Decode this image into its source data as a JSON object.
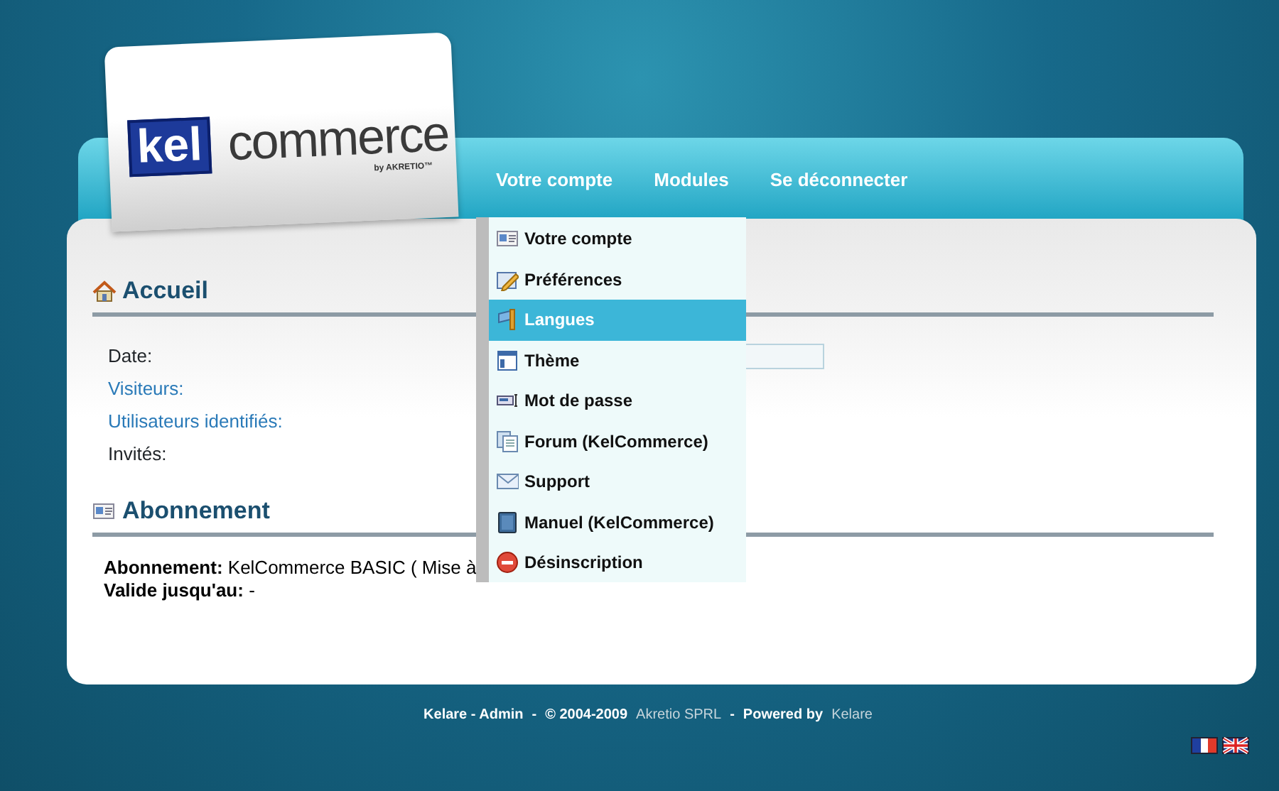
{
  "logo": {
    "mark": "kel",
    "wordmark": "commerce",
    "byline": "by AKRETIO™"
  },
  "nav": [
    {
      "label": "Votre compte"
    },
    {
      "label": "Modules"
    },
    {
      "label": "Se déconnecter"
    }
  ],
  "dropdown": [
    {
      "label": "Votre compte",
      "selected": false
    },
    {
      "label": "Préférences",
      "selected": false
    },
    {
      "label": "Langues",
      "selected": true
    },
    {
      "label": "Thème",
      "selected": false
    },
    {
      "label": "Mot de passe",
      "selected": false
    },
    {
      "label": "Forum (KelCommerce)",
      "selected": false
    },
    {
      "label": "Support",
      "selected": false
    },
    {
      "label": "Manuel (KelCommerce)",
      "selected": false
    },
    {
      "label": "Désinscription",
      "selected": false
    }
  ],
  "accueil": {
    "title": "Accueil",
    "rows": [
      {
        "label": "Date:",
        "kind": "field"
      },
      {
        "label": "Visiteurs:",
        "kind": "link"
      },
      {
        "label": "Utilisateurs identifiés:",
        "kind": "link"
      },
      {
        "label": "Invités:",
        "kind": "plain"
      }
    ]
  },
  "abonnement": {
    "title": "Abonnement",
    "lines": [
      "**Abonnement:** KelCommerce BASIC ( Mise à",
      "**Valide jusqu'au:** -"
    ]
  },
  "footer": [
    {
      "text": "Kelare - Admin",
      "kind": "plain"
    },
    {
      "text": "-",
      "kind": "plain"
    },
    {
      "text": "© 2004-2009",
      "kind": "plain"
    },
    {
      "text": "Akretio SPRL",
      "kind": "link"
    },
    {
      "text": "-",
      "kind": "plain"
    },
    {
      "text": "Powered by",
      "kind": "plain"
    },
    {
      "text": "Kelare",
      "kind": "link"
    }
  ]
}
